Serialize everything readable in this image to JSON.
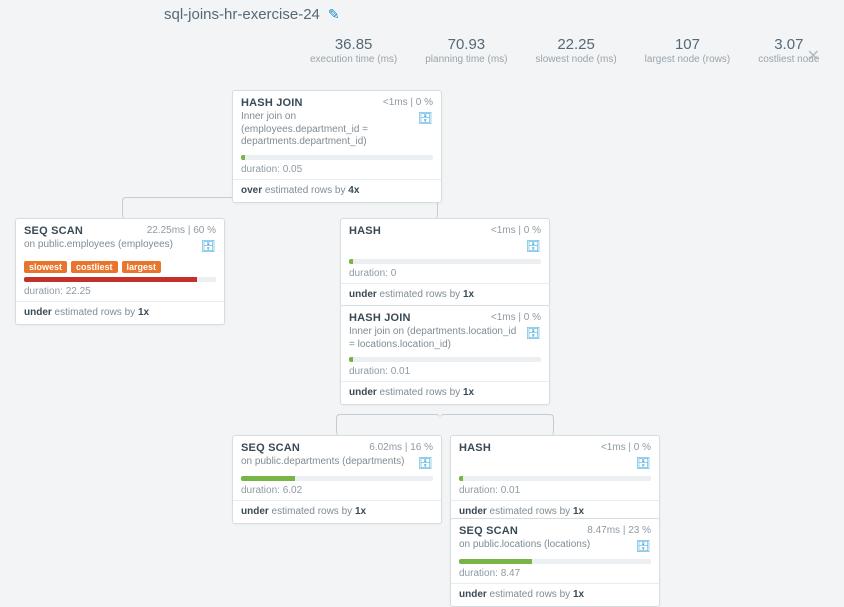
{
  "title": "sql-joins-hr-exercise-24",
  "metrics": [
    {
      "val": "36.85",
      "lbl": "execution time (ms)"
    },
    {
      "val": "70.93",
      "lbl": "planning time (ms)"
    },
    {
      "val": "22.25",
      "lbl": "slowest node (ms)"
    },
    {
      "val": "107",
      "lbl": "largest node (rows)"
    },
    {
      "val": "3.07",
      "lbl": "costliest node"
    }
  ],
  "nodes": {
    "hj1": {
      "title": "HASH JOIN",
      "stats": "<1ms | 0 %",
      "sub": "Inner join\non (employees.department_id = departments.department_id)",
      "dur": "duration: 0.05",
      "est_prefix": "over",
      "est_suffix": " estimated rows by ",
      "est_factor": "4x",
      "bar_color": "tiny",
      "bar_pct": 2
    },
    "seq_emp": {
      "title": "SEQ SCAN",
      "stats": "22.25ms | 60 %",
      "sub": "on public.employees (employees)",
      "badges": [
        "slowest",
        "costliest",
        "largest"
      ],
      "dur": "duration: 22.25",
      "est_prefix": "under",
      "est_suffix": " estimated rows by ",
      "est_factor": "1x",
      "bar_color": "red",
      "bar_pct": 90
    },
    "hash1": {
      "title": "HASH",
      "stats": "<1ms | 0 %",
      "sub": "",
      "dur": "duration: 0",
      "est_prefix": "under",
      "est_suffix": " estimated rows by ",
      "est_factor": "1x",
      "bar_color": "tiny",
      "bar_pct": 2
    },
    "hj2": {
      "title": "HASH JOIN",
      "stats": "<1ms | 0 %",
      "sub": "Inner join\non (departments.location_id = locations.location_id)",
      "dur": "duration: 0.01",
      "est_prefix": "under",
      "est_suffix": " estimated rows by ",
      "est_factor": "1x",
      "bar_color": "tiny",
      "bar_pct": 2
    },
    "seq_dep": {
      "title": "SEQ SCAN",
      "stats": "6.02ms | 16 %",
      "sub": "on public.departments (departments)",
      "dur": "duration: 6.02",
      "est_prefix": "under",
      "est_suffix": " estimated rows by ",
      "est_factor": "1x",
      "bar_color": "green",
      "bar_pct": 28
    },
    "hash2": {
      "title": "HASH",
      "stats": "<1ms | 0 %",
      "sub": "",
      "dur": "duration: 0.01",
      "est_prefix": "under",
      "est_suffix": " estimated rows by ",
      "est_factor": "1x",
      "bar_color": "tiny",
      "bar_pct": 2
    },
    "seq_loc": {
      "title": "SEQ SCAN",
      "stats": "8.47ms | 23 %",
      "sub": "on public.locations (locations)",
      "dur": "duration: 8.47",
      "est_prefix": "under",
      "est_suffix": " estimated rows by ",
      "est_factor": "1x",
      "bar_color": "green",
      "bar_pct": 38
    }
  }
}
